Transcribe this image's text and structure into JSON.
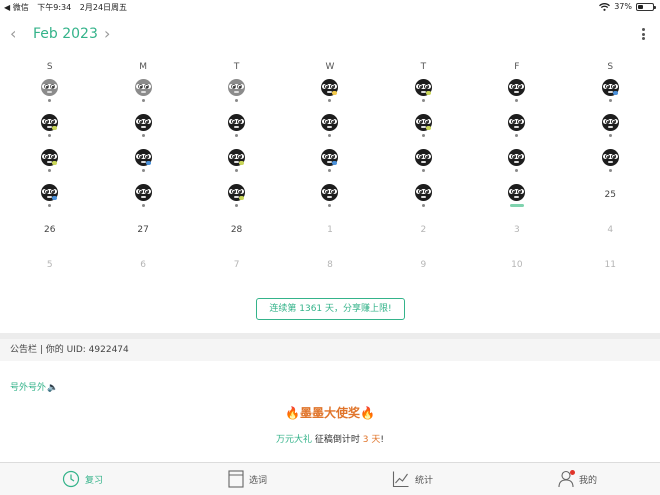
{
  "status_bar": {
    "back_app": "◀ 微信",
    "time": "下午9:34",
    "date": "2月24日周五",
    "battery": "37%",
    "battery_level": 0.37
  },
  "header": {
    "month_title": "Feb 2023",
    "prev_icon": "chevron-left-icon",
    "next_icon": "chevron-right-icon",
    "more_icon": "more-vertical-icon"
  },
  "calendar": {
    "weekdays": [
      "S",
      "M",
      "T",
      "W",
      "T",
      "F",
      "S"
    ],
    "weeks": [
      [
        {
          "icon": "panda-gray",
          "marker": "dot"
        },
        {
          "icon": "panda-gray",
          "marker": "dot"
        },
        {
          "icon": "panda-gray",
          "marker": "dot"
        },
        {
          "icon": "panda",
          "marker": "dot",
          "accent": "#f2c94c"
        },
        {
          "icon": "panda",
          "marker": "dot",
          "accent": "#c9d65a"
        },
        {
          "icon": "panda",
          "marker": "dot"
        },
        {
          "icon": "panda",
          "marker": "dot",
          "accent": "#4a90d9"
        }
      ],
      [
        {
          "icon": "panda",
          "marker": "dot",
          "accent": "#c9d65a"
        },
        {
          "icon": "panda",
          "marker": "dot"
        },
        {
          "icon": "panda",
          "marker": "dot"
        },
        {
          "icon": "panda",
          "marker": "dot"
        },
        {
          "icon": "panda",
          "marker": "dot",
          "accent": "#c9d65a"
        },
        {
          "icon": "panda",
          "marker": "dot"
        },
        {
          "icon": "panda",
          "marker": "dot"
        }
      ],
      [
        {
          "icon": "panda",
          "marker": "dot",
          "accent": "#c9d65a"
        },
        {
          "icon": "panda",
          "marker": "dot",
          "accent": "#4a90d9"
        },
        {
          "icon": "panda",
          "marker": "dot",
          "accent": "#c9d65a"
        },
        {
          "icon": "panda",
          "marker": "dot",
          "accent": "#4a90d9"
        },
        {
          "icon": "panda",
          "marker": "dot"
        },
        {
          "icon": "panda",
          "marker": "dot"
        },
        {
          "icon": "panda",
          "marker": "dot"
        }
      ],
      [
        {
          "icon": "panda",
          "marker": "dot",
          "accent": "#4a90d9"
        },
        {
          "icon": "panda",
          "marker": "dot"
        },
        {
          "icon": "panda",
          "marker": "dot",
          "accent": "#c9d65a"
        },
        {
          "icon": "panda",
          "marker": "dot"
        },
        {
          "icon": "panda",
          "marker": "dot"
        },
        {
          "icon": "panda",
          "marker": "bar"
        },
        {
          "num": "25",
          "style": "today"
        }
      ],
      [
        {
          "num": "26",
          "style": "current"
        },
        {
          "num": "27",
          "style": "current"
        },
        {
          "num": "28",
          "style": "current"
        },
        {
          "num": "1",
          "style": "other"
        },
        {
          "num": "2",
          "style": "other"
        },
        {
          "num": "3",
          "style": "other"
        },
        {
          "num": "4",
          "style": "other"
        }
      ],
      [
        {
          "num": "5",
          "style": "other"
        },
        {
          "num": "6",
          "style": "other"
        },
        {
          "num": "7",
          "style": "other"
        },
        {
          "num": "8",
          "style": "other"
        },
        {
          "num": "9",
          "style": "other"
        },
        {
          "num": "10",
          "style": "other"
        },
        {
          "num": "11",
          "style": "other"
        }
      ]
    ]
  },
  "streak_button": "连续第 1361 天，分享赚上限!",
  "notice_bar": "公告栏 | 你的 UID: 4922474",
  "extra_link": "号外号外",
  "speaker_icon": "speaker-icon",
  "promo": {
    "title": "🔥墨墨大使奖🔥",
    "sub_part1": "万元大礼",
    "sub_part2": " 征稿倒计时 ",
    "sub_part3": "3 天",
    "sub_part4": "!"
  },
  "colors": {
    "accent": "#34b38a",
    "promo": "#e0742a"
  },
  "tabs": [
    {
      "label": "复习",
      "icon": "clock-icon",
      "active": true
    },
    {
      "label": "选词",
      "icon": "book-icon",
      "active": false
    },
    {
      "label": "统计",
      "icon": "chart-icon",
      "active": false
    },
    {
      "label": "我的",
      "icon": "user-icon",
      "active": false,
      "badge": true
    }
  ]
}
